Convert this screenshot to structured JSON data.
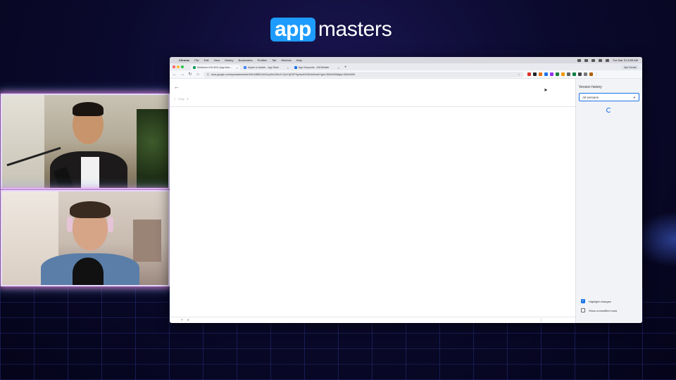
{
  "brand": {
    "badge": "app",
    "rest": "masters",
    "accent": "#1e9bff"
  },
  "menubar": {
    "app": "Chrome",
    "items": [
      "File",
      "Edit",
      "View",
      "History",
      "Bookmarks",
      "Profiles",
      "Tab",
      "Window",
      "Help"
    ],
    "clock": "Tue Mar 31  8:58 AM"
  },
  "tabs": [
    {
      "title": "SimDeum iOS ASO (App Mon...",
      "active": true,
      "favicon_color": "#0f9d58"
    },
    {
      "title": "Aspire to tracker - App Store",
      "active": false,
      "favicon_color": "#4285f4"
    },
    {
      "title": "App Keywords - ASOMobile",
      "active": false,
      "favicon_color": "#1a73e8"
    }
  ],
  "profile": "Ask Gemini",
  "omnibox": {
    "url": "docs.google.com/spreadsheets/d/1MrU4BBCAIUUcp0hcGMuYL2pYr1jEDFSycfw4r2NDbAHbxd0?gid=306440958gid=30644095"
  },
  "formula_bar": {
    "cell": "Only",
    "sep": "▾"
  },
  "version_history": {
    "title": "Version history",
    "filter": "All versions",
    "options": [
      {
        "label": "Highlight changes",
        "checked": true
      },
      {
        "label": "Show unmodified rows",
        "checked": false
      }
    ]
  },
  "footer": {
    "add": "+",
    "menu": "≡"
  }
}
